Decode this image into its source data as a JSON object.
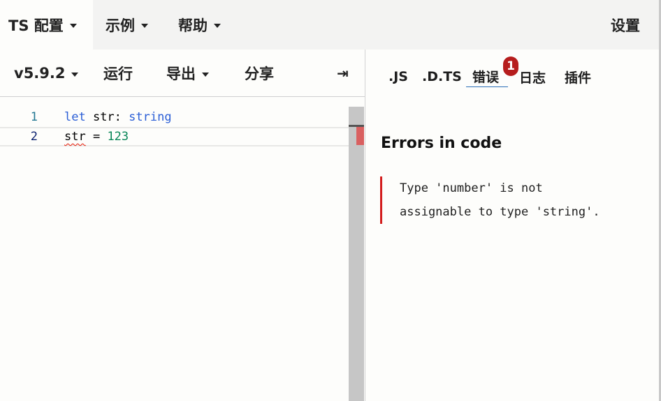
{
  "topnav": {
    "items": [
      {
        "label": "TS 配置"
      },
      {
        "label": "示例"
      },
      {
        "label": "帮助"
      }
    ],
    "settings_label": "设置"
  },
  "toolbar": {
    "version": "v5.9.2",
    "run": "运行",
    "export": "导出",
    "share": "分享",
    "collapse_glyph": "⇥"
  },
  "editor": {
    "lines": [
      {
        "num": "1",
        "tokens": {
          "kw": "let",
          "ident": " str: ",
          "type": "string"
        }
      },
      {
        "num": "2",
        "tokens": {
          "ident": "str",
          "op": " = ",
          "num": "123"
        }
      }
    ]
  },
  "sidebar": {
    "tabs": [
      {
        "label": ".JS"
      },
      {
        "label": ".D.TS"
      },
      {
        "label": "错误"
      },
      {
        "label": "日志"
      },
      {
        "label": "插件"
      }
    ],
    "active_tab": "错误",
    "error_count": "1",
    "errors_title": "Errors in code",
    "error_message_line1": "Type 'number' is not",
    "error_message_line2": "assignable to type 'string'."
  },
  "colors": {
    "accent_underline": "#2a6fb8",
    "error_badge": "#b61d1d",
    "error_border": "#d31d1d"
  }
}
